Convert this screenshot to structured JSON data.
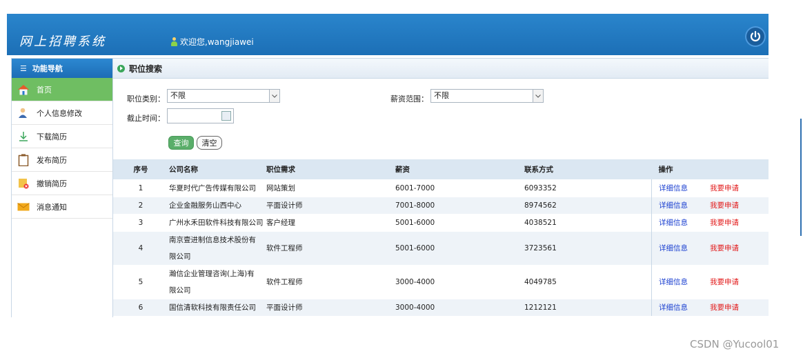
{
  "header": {
    "brand": "网上招聘系统",
    "welcome": "欢迎您,wangjiawei"
  },
  "sidebar": {
    "title": "功能导航",
    "items": [
      {
        "label": "首页",
        "icon": "home-icon"
      },
      {
        "label": "个人信息修改",
        "icon": "user-edit-icon"
      },
      {
        "label": "下载简历",
        "icon": "download-icon"
      },
      {
        "label": "发布简历",
        "icon": "clipboard-icon"
      },
      {
        "label": "撤销简历",
        "icon": "revoke-icon"
      },
      {
        "label": "消息通知",
        "icon": "mail-icon"
      }
    ]
  },
  "search": {
    "title": "职位搜索",
    "category_label": "职位类别：",
    "category_value": "不限",
    "salary_label": "薪资范围：",
    "salary_value": "不限",
    "deadline_label": "截止时间：",
    "query_button": "查询",
    "clear_button": "清空"
  },
  "table": {
    "headers": [
      "序号",
      "公司名称",
      "职位需求",
      "薪资",
      "联系方式",
      "操作"
    ],
    "action_detail": "详细信息",
    "action_apply": "我要申请",
    "rows": [
      [
        "1",
        "华夏时代广告传媒有限公司",
        "网站策划",
        "6001-7000",
        "6093352"
      ],
      [
        "2",
        "企业金融服务山西中心",
        "平面设计师",
        "7001-8000",
        "8974562"
      ],
      [
        "3",
        "广州水禾田软件科技有限公司",
        "客户经理",
        "5001-6000",
        "4038521"
      ],
      [
        "4",
        "南京壹进制信息技术股份有限公司",
        "软件工程师",
        "5001-6000",
        "3723561"
      ],
      [
        "5",
        "瀚信企业管理咨询(上海)有限公司",
        "软件工程师",
        "3000-4000",
        "4049785"
      ],
      [
        "6",
        "国信清软科技有限责任公司",
        "平面设计师",
        "3000-4000",
        "1212121"
      ]
    ]
  },
  "watermark": "CSDN @Yucool01",
  "colors": {
    "header_blue": "#1c6fb6",
    "active_green": "#6fbe62",
    "detail_blue": "#1a3fd0",
    "apply_red": "#e21b1b"
  }
}
